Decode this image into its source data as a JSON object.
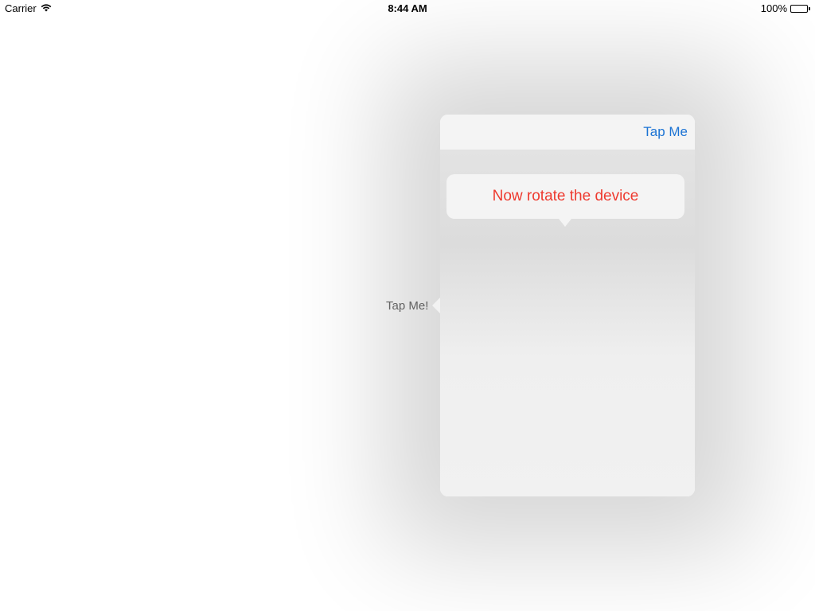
{
  "status_bar": {
    "carrier": "Carrier",
    "time": "8:44 AM",
    "battery": "100%"
  },
  "main": {
    "tap_me_button": "Tap Me!"
  },
  "popover": {
    "nav_button": "Tap Me",
    "tooltip_text": "Now rotate the device"
  },
  "colors": {
    "link_blue": "#1b73d4",
    "tooltip_red": "#ee3a2f",
    "popover_background": "#f2f2f2"
  },
  "icons": [
    "wifi-icon",
    "battery-icon"
  ]
}
